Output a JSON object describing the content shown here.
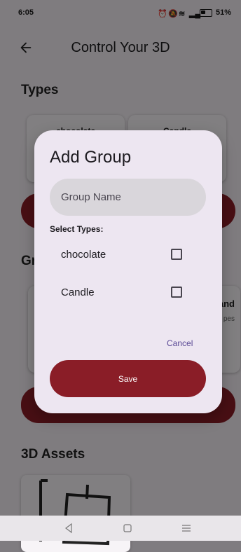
{
  "status": {
    "time": "6:05",
    "battery": "51%"
  },
  "appbar": {
    "title": "Control Your 3D"
  },
  "sections": {
    "types": "Types",
    "groups_partial": "Gr",
    "assets": "3D Assets"
  },
  "type_cards": [
    "chocolate",
    "Candle"
  ],
  "group_cards": [
    {
      "partial_title": "and",
      "partial_subtitle": "pes"
    }
  ],
  "dialog": {
    "title": "Add Group",
    "input_placeholder": "Group Name",
    "select_label": "Select Types:",
    "types": [
      {
        "label": "chocolate",
        "checked": false
      },
      {
        "label": "Candle",
        "checked": false
      }
    ],
    "cancel": "Cancel",
    "save": "Save"
  },
  "colors": {
    "accent": "#8a1d27",
    "dialog": "#ede6f1",
    "link": "#5b4a96"
  }
}
